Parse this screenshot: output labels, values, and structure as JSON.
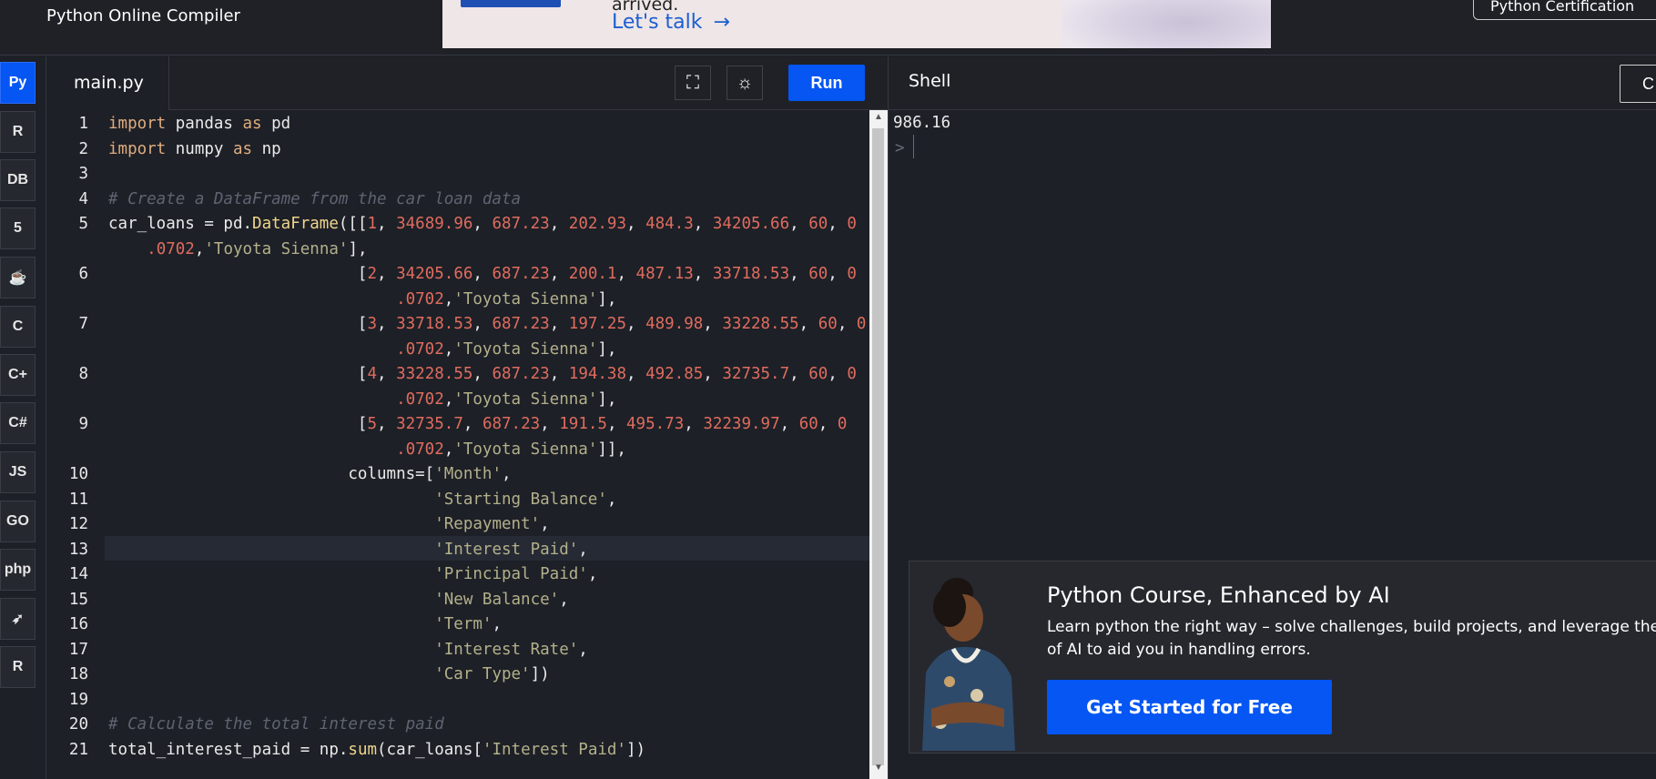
{
  "header": {
    "brand": "Python Online Compiler",
    "ad": {
      "line1": "arrived.",
      "cta": "Let's talk",
      "arrow": "→"
    },
    "cert_button": "Python Certification"
  },
  "rail": [
    {
      "name": "python-icon",
      "label": "Py",
      "active": true
    },
    {
      "name": "r-icon",
      "label": "R"
    },
    {
      "name": "database-icon",
      "label": "DB"
    },
    {
      "name": "html5-icon",
      "label": "5"
    },
    {
      "name": "java-icon",
      "label": "☕"
    },
    {
      "name": "c-icon",
      "label": "C"
    },
    {
      "name": "cpp-icon",
      "label": "C+"
    },
    {
      "name": "csharp-icon",
      "label": "C#"
    },
    {
      "name": "js-icon",
      "label": "JS"
    },
    {
      "name": "go-icon",
      "label": "GO"
    },
    {
      "name": "php-icon",
      "label": "php"
    },
    {
      "name": "swift-icon",
      "label": "➶"
    },
    {
      "name": "rust-icon",
      "label": "R"
    }
  ],
  "editor": {
    "tab": "main.py",
    "run": "Run",
    "fullscreen_icon": "⛶",
    "theme_icon": "☼"
  },
  "code_lines": [
    {
      "n": "1",
      "html": "<span class='kw'>import</span> pandas <span class='kw'>as</span> pd"
    },
    {
      "n": "2",
      "html": "<span class='kw'>import</span> numpy <span class='kw'>as</span> np"
    },
    {
      "n": "3",
      "html": ""
    },
    {
      "n": "4",
      "html": "<span class='cm'># Create a DataFrame from the car loan data</span>"
    },
    {
      "n": "5",
      "html": "car_loans = pd.<span class='fn'>DataFrame</span>([[<span class='num'>1</span>, <span class='num'>34689.96</span>, <span class='num'>687.23</span>, <span class='num'>202.93</span>, <span class='num'>484.3</span>, <span class='num'>34205.66</span>, <span class='num'>60</span>, <span class='num'>0</span>"
    },
    {
      "n": "",
      "html": "    <span class='num'>.0702</span>,<span class='str'>'Toyota Sienna'</span>],"
    },
    {
      "n": "6",
      "html": "                          [<span class='num'>2</span>, <span class='num'>34205.66</span>, <span class='num'>687.23</span>, <span class='num'>200.1</span>, <span class='num'>487.13</span>, <span class='num'>33718.53</span>, <span class='num'>60</span>, <span class='num'>0</span>"
    },
    {
      "n": "",
      "html": "                              <span class='num'>.0702</span>,<span class='str'>'Toyota Sienna'</span>],"
    },
    {
      "n": "7",
      "html": "                          [<span class='num'>3</span>, <span class='num'>33718.53</span>, <span class='num'>687.23</span>, <span class='num'>197.25</span>, <span class='num'>489.98</span>, <span class='num'>33228.55</span>, <span class='num'>60</span>, <span class='num'>0</span>"
    },
    {
      "n": "",
      "html": "                              <span class='num'>.0702</span>,<span class='str'>'Toyota Sienna'</span>],"
    },
    {
      "n": "8",
      "html": "                          [<span class='num'>4</span>, <span class='num'>33228.55</span>, <span class='num'>687.23</span>, <span class='num'>194.38</span>, <span class='num'>492.85</span>, <span class='num'>32735.7</span>, <span class='num'>60</span>, <span class='num'>0</span>"
    },
    {
      "n": "",
      "html": "                              <span class='num'>.0702</span>,<span class='str'>'Toyota Sienna'</span>],"
    },
    {
      "n": "9",
      "html": "                          [<span class='num'>5</span>, <span class='num'>32735.7</span>, <span class='num'>687.23</span>, <span class='num'>191.5</span>, <span class='num'>495.73</span>, <span class='num'>32239.97</span>, <span class='num'>60</span>, <span class='num'>0</span>"
    },
    {
      "n": "",
      "html": "                              <span class='num'>.0702</span>,<span class='str'>'Toyota Sienna'</span>]],"
    },
    {
      "n": "10",
      "html": "                         columns=[<span class='str'>'Month'</span>,"
    },
    {
      "n": "11",
      "html": "                                  <span class='str'>'Starting Balance'</span>,"
    },
    {
      "n": "12",
      "html": "                                  <span class='str'>'Repayment'</span>,"
    },
    {
      "n": "13",
      "html": "                                  <span class='str'>'Interest Paid'</span>,"
    },
    {
      "n": "14",
      "html": "                                  <span class='str'>'Principal Paid'</span>,"
    },
    {
      "n": "15",
      "html": "                                  <span class='str'>'New Balance'</span>,"
    },
    {
      "n": "16",
      "html": "                                  <span class='str'>'Term'</span>,"
    },
    {
      "n": "17",
      "html": "                                  <span class='str'>'Interest Rate'</span>,"
    },
    {
      "n": "18",
      "html": "                                  <span class='str'>'Car Type'</span>])"
    },
    {
      "n": "19",
      "html": ""
    },
    {
      "n": "20",
      "html": "<span class='cm'># Calculate the total interest paid</span>"
    },
    {
      "n": "21",
      "html": "total_interest_paid = np.<span class='fn'>sum</span>(car_loans[<span class='str'>'Interest Paid'</span>])"
    }
  ],
  "shell": {
    "title": "Shell",
    "clear": "C",
    "output": "986.16",
    "prompt": ">"
  },
  "course_ad": {
    "title": "Python Course, Enhanced by AI",
    "description": "Learn python the right way – solve challenges, build projects, and leverage the po",
    "description2": "of AI to aid you in handling errors.",
    "button": "Get Started for Free"
  },
  "colors": {
    "accent": "#0556f3",
    "keyword": "#e0ad7e",
    "number": "#e06c5e",
    "string": "#b4b08a",
    "comment": "#5e6470"
  }
}
